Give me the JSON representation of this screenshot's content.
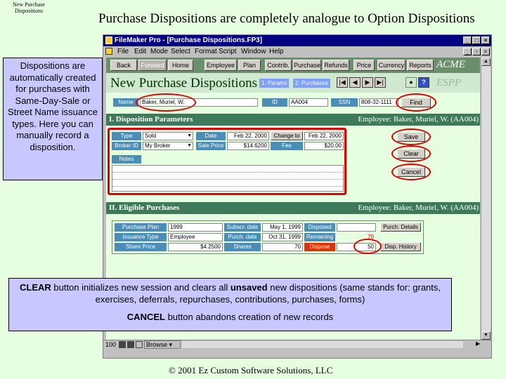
{
  "slide": {
    "corner_label": "New Purchase Dispositions",
    "title": "Purchase Dispositions are completely analogue to Option Dispositions",
    "footer": "© 2001 Ez Custom Software Solutions, LLC"
  },
  "callouts": {
    "left_note": "Dispositions are automatically created for purchases with Same-Day-Sale or Street Name issuance types. Here you can manually record a disposition.",
    "clear_prefix": "CLEAR",
    "clear_mid": " button initializes new session and clears all ",
    "clear_emph": "unsaved",
    "clear_rest": " new dispositions (same stands for: grants, exercises, deferrals, repurchases, contributions, purchases, forms)",
    "cancel_prefix": "CANCEL",
    "cancel_rest": " button abandons creation of new records"
  },
  "window": {
    "title": "FileMaker Pro - [Purchase Dispositions.FP3]",
    "menu": [
      "File",
      "Edit",
      "Mode",
      "Select",
      "Format",
      "Script",
      "Window",
      "Help"
    ]
  },
  "nav": {
    "buttons": [
      "Back",
      "Forward",
      "Home",
      "Employee",
      "Plan",
      "Contrib.",
      "Purchase",
      "Refunds",
      "Price",
      "Currency",
      "Reports"
    ],
    "brand_top": "ACME",
    "brand_bottom": "ESPP"
  },
  "header": {
    "title": "New Purchase Dispositions",
    "tab1": "1. Params",
    "tab2": "2. Purchases",
    "nav_arrows": [
      "|◀",
      "◀",
      "▶",
      "▶|"
    ],
    "help": "?"
  },
  "employee": {
    "name_label": "Name",
    "name_value": "Baker, Muriel, W.",
    "id_label": "ID",
    "id_value": "AA004",
    "ssn_label": "SSN",
    "ssn_value": "808-32-1111",
    "find_label": "Find"
  },
  "section1": {
    "title": "I. Disposition Parameters",
    "employee_text": "Employee: Baker, Muriel, W. (AA004)",
    "type_label": "Type",
    "type_value": "Sold",
    "broker_label": "Broker ID",
    "broker_value": "My Broker",
    "date_label": "Date",
    "date_value": "Feb 22, 2000",
    "change_to_label": "Change to",
    "change_to_value": "Feb 22, 2000",
    "sale_price_label": "Sale Price",
    "sale_price_value": "$14.6200",
    "fee_label": "Fee",
    "fee_value": "$20.00",
    "notes_label": "Notes",
    "save_label": "Save",
    "clear_label": "Clear",
    "cancel_label": "Cancel"
  },
  "section2": {
    "title": "II. Eligible Purchases",
    "employee_text": "Employee: Baker, Muriel, W. (AA004)",
    "plan_label": "Purchase Plan",
    "plan_value": "1999",
    "issuance_label": "Issuance Type",
    "issuance_value": "Employee",
    "share_price_label": "Share Price",
    "share_price_value": "$4.2500",
    "subscr_label": "Subscr. date",
    "subscr_value": "May 1, 1999",
    "purch_label": "Purch. date",
    "purch_value": "Oct 31, 1999",
    "shares_label": "Shares",
    "shares_value": "70",
    "disposed_label": "Disposed",
    "disposed_value": "",
    "remaining_label": "Remaining",
    "remaining_value": "70",
    "dispose_label": "Dispose",
    "dispose_value": "50",
    "purch_details_label": "Purch. Details",
    "disp_history_label": "Disp. History"
  },
  "statusbar": {
    "zoom": "100",
    "mode": "Browse"
  }
}
